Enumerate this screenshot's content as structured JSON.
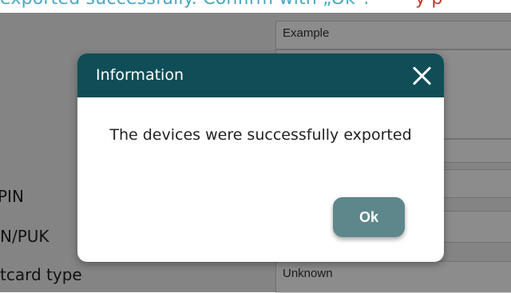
{
  "instruction": {
    "text": "exported successfully. Confirm with „Ok\".",
    "trailing": "y p"
  },
  "form": {
    "name_value": "Example",
    "labels": [
      "PIN",
      "N/PUK",
      "tcard type"
    ],
    "card_type_value": "Unknown"
  },
  "dialog": {
    "title": "Information",
    "message": "The devices were successfully exported",
    "ok_label": "Ok",
    "close_icon": "close-icon",
    "header_color": "#0f4d57",
    "button_color": "#5e878b"
  }
}
